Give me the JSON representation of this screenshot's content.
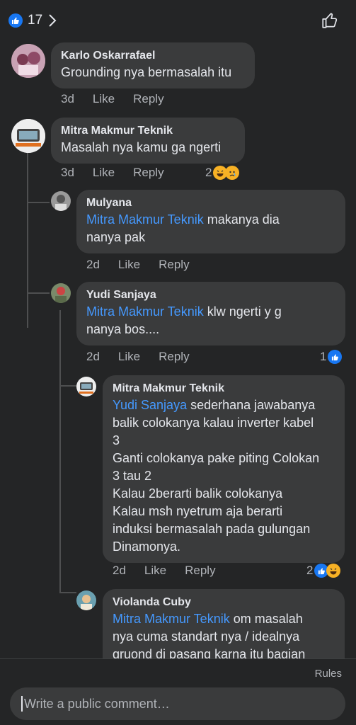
{
  "header": {
    "like_count": "17"
  },
  "comments": [
    {
      "author": "Karlo Oskarrafael",
      "mention": "",
      "text": "Grounding nya bermasalah itu",
      "time": "3d",
      "like": "Like",
      "reply": "Reply",
      "react_count": ""
    },
    {
      "author": "Mitra Makmur Teknik",
      "mention": "",
      "text": "Masalah nya kamu ga ngerti",
      "time": "3d",
      "like": "Like",
      "reply": "Reply",
      "react_count": "2"
    },
    {
      "author": "Mulyana",
      "mention": "Mitra Makmur Teknik",
      "text": " makanya dia\nnanya pak",
      "time": "2d",
      "like": "Like",
      "reply": "Reply",
      "react_count": ""
    },
    {
      "author": "Yudi Sanjaya",
      "mention": "Mitra Makmur Teknik",
      "text": " klw ngerti y g\nnanya bos....",
      "time": "2d",
      "like": "Like",
      "reply": "Reply",
      "react_count": "1"
    },
    {
      "author": "Mitra Makmur Teknik",
      "mention": "Yudi Sanjaya",
      "text": " sederhana jawabanya\nbalik colokanya kalau inverter kabel\n3\nGanti colokanya pake piting Colokan\n3 tau 2\nKalau 2berarti balik colokanya\nKalau msh nyetrum aja berarti\ninduksi bermasalah pada gulungan\nDinamonya.",
      "time": "2d",
      "like": "Like",
      "reply": "Reply",
      "react_count": "2"
    },
    {
      "author": "Violanda Cuby",
      "mention": "Mitra Makmur Teknik",
      "text": " om masalah\nnya cuma standart nya / idealnya\ngruond di pasang karna itu bagian",
      "time": "",
      "like": "",
      "reply": "",
      "react_count": ""
    }
  ],
  "footer": {
    "rules": "Rules",
    "placeholder": "Write a public comment…"
  },
  "colors": {
    "background": "#242526",
    "bubble": "#3a3b3c",
    "mention": "#4599ff",
    "like_blue": "#1877f2"
  },
  "icons": [
    "like-icon",
    "chevron-right-icon",
    "thumbs-up-outline-icon",
    "haha-icon",
    "sad-icon"
  ]
}
